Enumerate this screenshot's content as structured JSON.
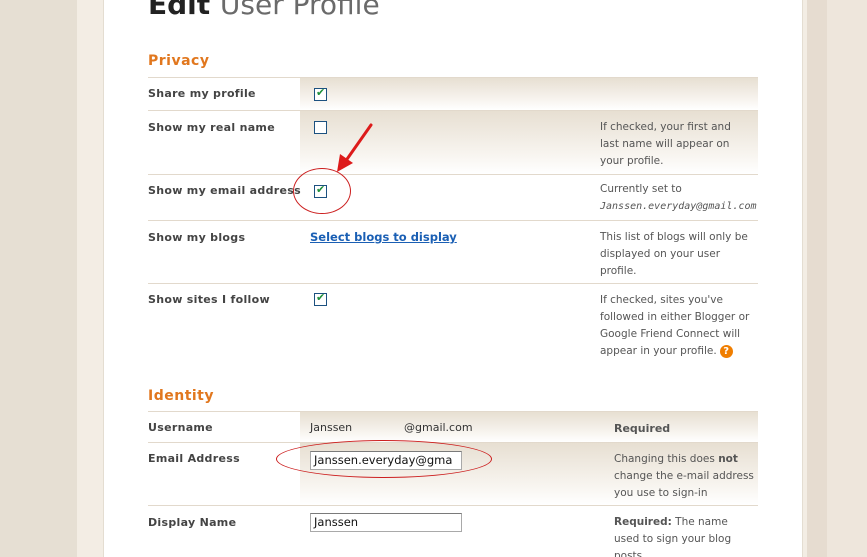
{
  "page": {
    "title_bold": "Edit",
    "title_light": "User Profile"
  },
  "privacy": {
    "title": "Privacy",
    "rows": [
      {
        "label": "Share my profile",
        "checked": true,
        "help": ""
      },
      {
        "label": "Show my real name",
        "checked": false,
        "help": "If checked, your first and last name will appear on your profile."
      },
      {
        "label": "Show my email address",
        "checked": true,
        "help_prefix": "Currently set to",
        "help_value": "Janssen.everyday@gmail.com"
      },
      {
        "label": "Show my blogs",
        "link": "Select blogs to display",
        "help": "This list of blogs will only be displayed on your user profile."
      },
      {
        "label": "Show sites I follow",
        "checked": true,
        "help": "If checked, sites you've followed in either Blogger or Google Friend Connect will appear in your profile.",
        "help_icon": "?"
      }
    ]
  },
  "identity": {
    "title": "Identity",
    "username": {
      "label": "Username",
      "name": "Janssen",
      "domain": "@gmail.com",
      "required": "Required"
    },
    "email": {
      "label": "Email Address",
      "value": "Janssen.everyday@gma",
      "help_a": "Changing this does",
      "help_not": "not",
      "help_b": "change the e-mail address you use to sign-in"
    },
    "display_name": {
      "label": "Display Name",
      "value": "Janssen",
      "help_required": "Required:",
      "help": "The name used to sign your blog posts."
    }
  },
  "colors": {
    "section_title": "#e1771e",
    "link": "#1a5fb4",
    "annotation": "#cc1f1f",
    "checkbox_tick": "#1e8f3a"
  },
  "icons": [
    "checkmark-icon",
    "help-question-icon",
    "red-arrow-annotation",
    "red-ellipse-annotation"
  ]
}
